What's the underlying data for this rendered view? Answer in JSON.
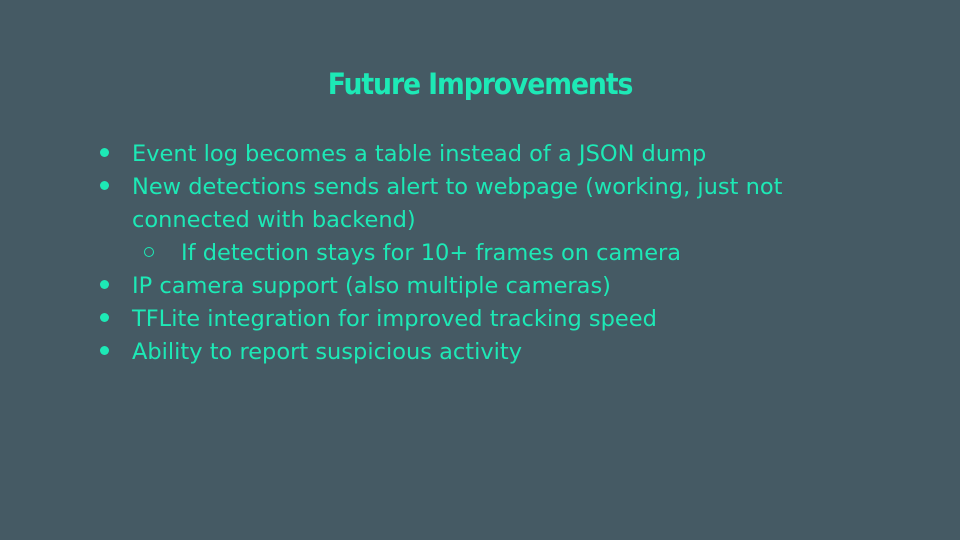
{
  "slide": {
    "title": "Future Improvements",
    "text_color": "#1de9b6",
    "background_color": "#455a64",
    "bullets": [
      {
        "level": 1,
        "marker": "filled-dot",
        "text": "Event log becomes a table instead of a JSON dump"
      },
      {
        "level": 1,
        "marker": "filled-dot",
        "text": "New detections sends alert to webpage (working, just not connected with backend)"
      },
      {
        "level": 2,
        "marker": "hollow-circle",
        "text": "If detection stays for 10+ frames on camera"
      },
      {
        "level": 1,
        "marker": "filled-dot",
        "text": "IP camera support (also multiple cameras)"
      },
      {
        "level": 1,
        "marker": "filled-dot",
        "text": "TFLite integration for improved tracking speed"
      },
      {
        "level": 1,
        "marker": "filled-dot",
        "text": "Ability to report suspicious activity"
      }
    ]
  }
}
